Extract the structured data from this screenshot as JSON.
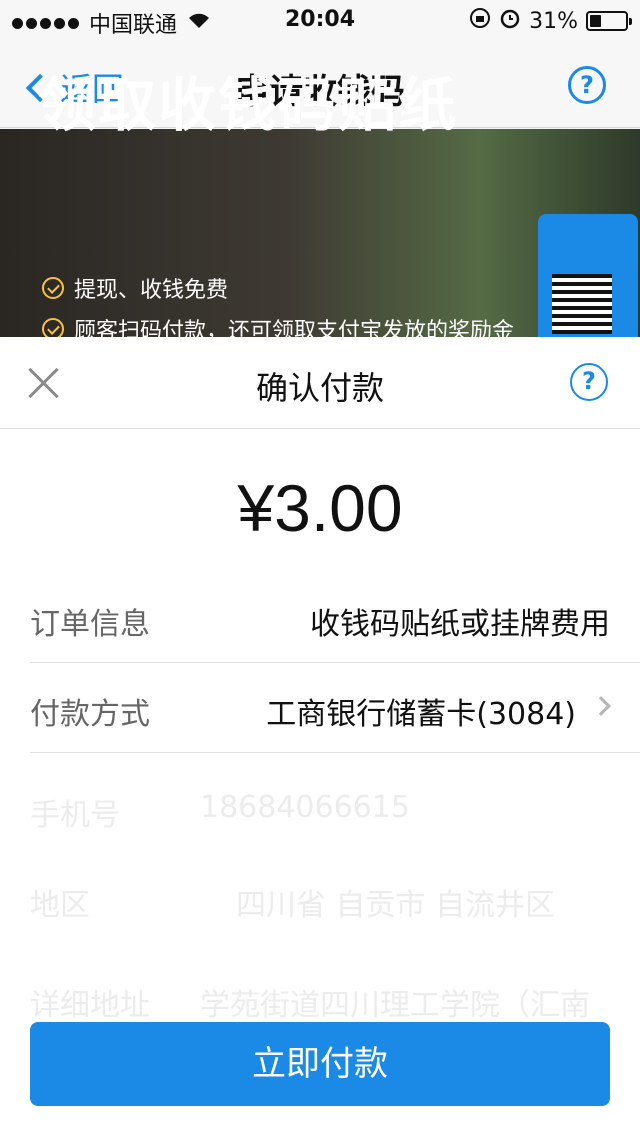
{
  "status_bar": {
    "carrier": "中国联通",
    "time": "20:04",
    "battery": "31%",
    "battery_level": 0.31
  },
  "nav": {
    "back_label": "返回",
    "title": "申请收钱码",
    "help_icon": "question-circle-icon"
  },
  "banner": {
    "title": "领取收钱码贴纸",
    "bullets": [
      "提现、收钱免费",
      "顾客扫码付款，还可领取支付宝发放的奖励金"
    ]
  },
  "background_form": {
    "phone_label": "手机号",
    "phone_value": "18684066615",
    "region_label": "地区",
    "region_value": "四川省 自贡市 自流井区",
    "address_label": "详细地址",
    "address_value": "学苑街道四川理工学院（汇南校区）"
  },
  "payment_sheet": {
    "title": "确认付款",
    "close_icon": "close-icon",
    "help_icon": "question-circle-icon",
    "amount": "¥3.00",
    "order_label": "订单信息",
    "order_value": "收钱码贴纸或挂牌费用",
    "method_label": "付款方式",
    "method_value": "工商银行储蓄卡(3084)",
    "pay_button": "立即付款"
  },
  "colors": {
    "accent": "#1a8ae6",
    "banner_check": "#f5c24a"
  }
}
